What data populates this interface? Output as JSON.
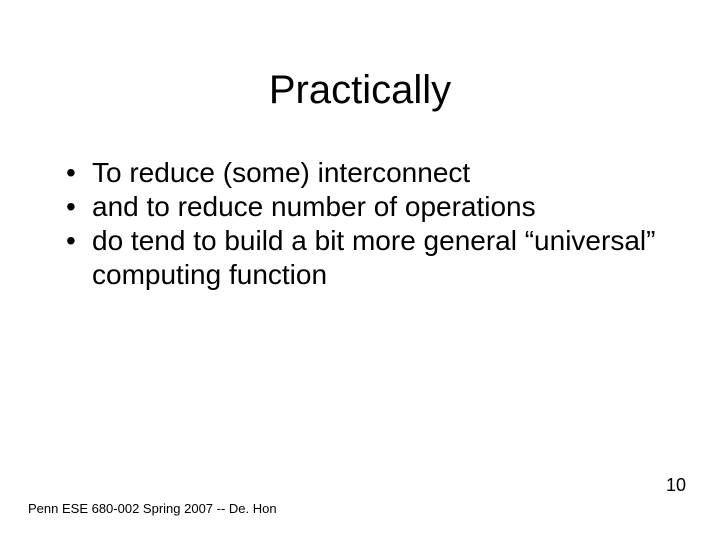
{
  "title": "Practically",
  "bullets": [
    "To reduce (some) interconnect",
    "and to reduce number of operations",
    "do tend to build a bit more general “universal” computing function"
  ],
  "footer": "Penn ESE 680-002 Spring 2007 -- De. Hon",
  "page_number": "10"
}
